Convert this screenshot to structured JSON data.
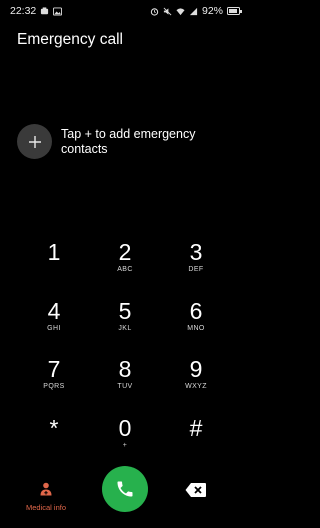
{
  "status_bar": {
    "time": "22:32",
    "battery": "92%",
    "battery_level": 0.92
  },
  "header": {
    "title": "Emergency call"
  },
  "add_contact": {
    "text": "Tap + to add emergency contacts"
  },
  "keypad": {
    "keys": [
      {
        "digit": "1",
        "letters": ""
      },
      {
        "digit": "2",
        "letters": "ABC"
      },
      {
        "digit": "3",
        "letters": "DEF"
      },
      {
        "digit": "4",
        "letters": "GHI"
      },
      {
        "digit": "5",
        "letters": "JKL"
      },
      {
        "digit": "6",
        "letters": "MNO"
      },
      {
        "digit": "7",
        "letters": "PQRS"
      },
      {
        "digit": "8",
        "letters": "TUV"
      },
      {
        "digit": "9",
        "letters": "WXYZ"
      },
      {
        "digit": "*",
        "letters": ""
      },
      {
        "digit": "0",
        "letters": "+"
      },
      {
        "digit": "#",
        "letters": ""
      }
    ]
  },
  "bottom": {
    "medical_label": "Medical info",
    "colors": {
      "call": "#27b14d",
      "medical": "#e0674a"
    }
  }
}
